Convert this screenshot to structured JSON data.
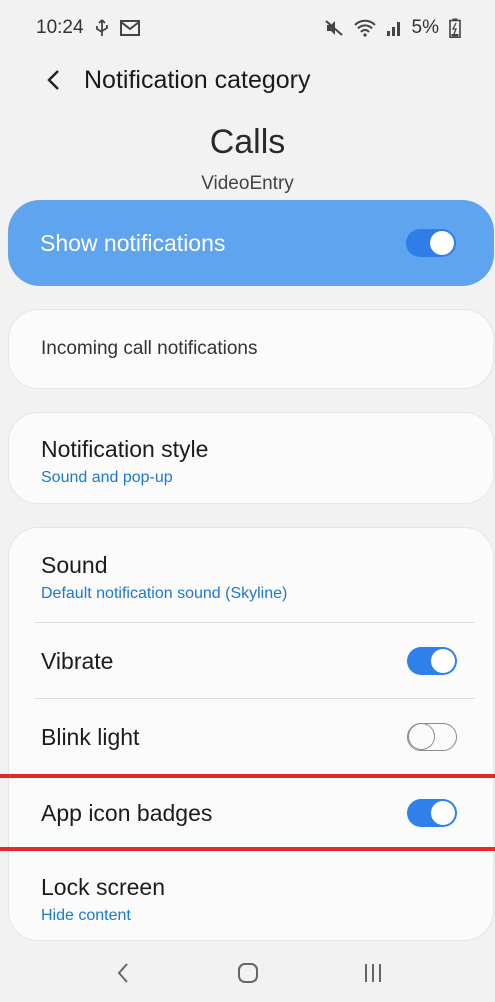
{
  "status_bar": {
    "time": "10:24",
    "battery": "5%",
    "icons_left": [
      "usb-icon",
      "gmail-icon"
    ],
    "icons_right": [
      "mute-icon",
      "wifi-icon",
      "signal-icon",
      "battery-icon"
    ]
  },
  "header": {
    "title": "Notification category"
  },
  "channel": {
    "name": "Calls",
    "app_name": "VideoEntry"
  },
  "master_switch": {
    "label": "Show notifications",
    "enabled": true
  },
  "description": {
    "text": "Incoming call notifications"
  },
  "notification_style": {
    "title": "Notification style",
    "value": "Sound and pop-up"
  },
  "settings": {
    "sound": {
      "title": "Sound",
      "value": "Default notification sound (Skyline)"
    },
    "vibrate": {
      "title": "Vibrate",
      "enabled": true
    },
    "blink_light": {
      "title": "Blink light",
      "enabled": false
    },
    "app_icon_badges": {
      "title": "App icon badges",
      "enabled": true
    },
    "lock_screen": {
      "title": "Lock screen",
      "value": "Hide content"
    }
  },
  "colors": {
    "accent": "#2f80e8",
    "master_card": "#5fa4ef",
    "link": "#1c78d4",
    "highlight": "#e12b2b",
    "background": "#f2f2f2"
  },
  "nav_bar": {
    "buttons": [
      "back-icon",
      "home-icon",
      "recents-icon"
    ]
  }
}
